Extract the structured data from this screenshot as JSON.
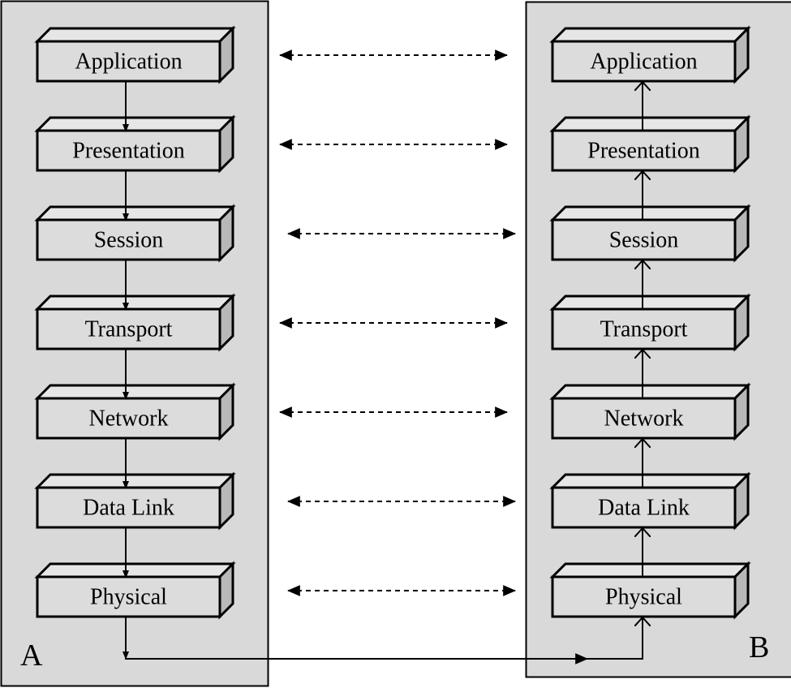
{
  "stacks": [
    {
      "label": "A",
      "direction": "down"
    },
    {
      "label": "B",
      "direction": "up"
    }
  ],
  "layers": [
    "Application",
    "Presentation",
    "Session",
    "Transport",
    "Network",
    "Data Link",
    "Physical"
  ],
  "colors": {
    "panel": "#d9d9d9",
    "box_front": "#dcdcdc",
    "box_top": "#e6e6e6",
    "box_side": "#b8b8b8",
    "stroke": "#000000"
  }
}
